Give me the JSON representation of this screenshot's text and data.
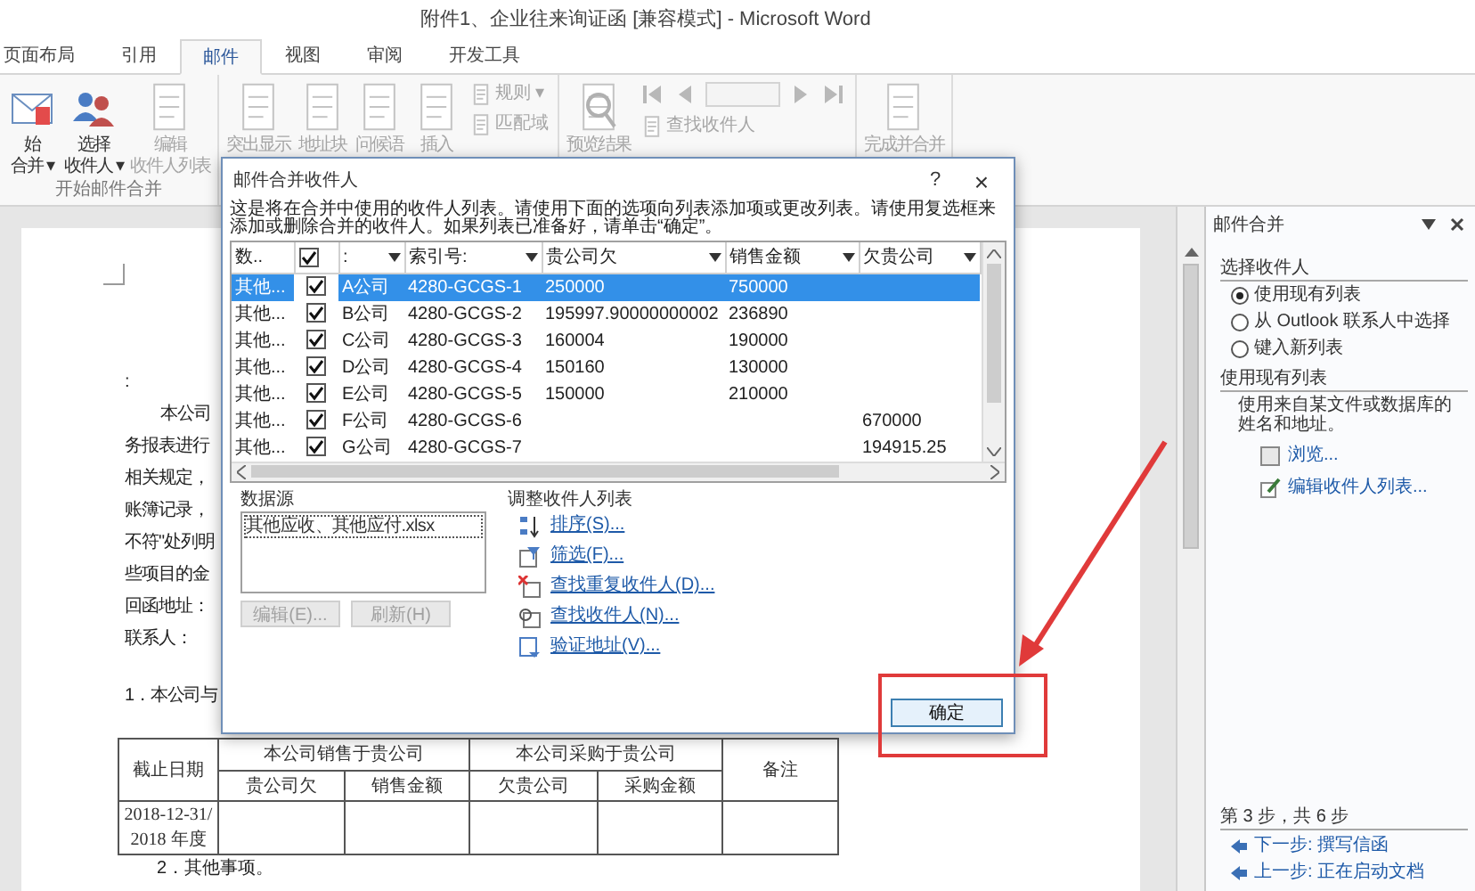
{
  "window": {
    "title": "附件1、企业往来询证函 [兼容模式] - Microsoft Word"
  },
  "tabs": [
    {
      "label": "页面布局",
      "selected": false
    },
    {
      "label": "引用",
      "selected": false
    },
    {
      "label": "邮件",
      "selected": true
    },
    {
      "label": "视图",
      "selected": false
    },
    {
      "label": "审阅",
      "selected": false
    },
    {
      "label": "开发工具",
      "selected": false
    }
  ],
  "ribbon_groups": [
    {
      "label": "开始邮件合并",
      "items": [
        {
          "kind": "large",
          "lines": [
            "始",
            "合并 ▾"
          ],
          "disabled": false
        },
        {
          "kind": "large",
          "lines": [
            "选择",
            "收件人 ▾"
          ],
          "disabled": false
        },
        {
          "kind": "large",
          "lines": [
            "编辑",
            "收件人列表"
          ],
          "disabled": true
        }
      ]
    },
    {
      "items": [
        {
          "kind": "large",
          "lines": [
            "突出显示"
          ],
          "disabled": true
        },
        {
          "kind": "large",
          "lines": [
            "地址块"
          ],
          "disabled": true
        },
        {
          "kind": "large",
          "lines": [
            "问候语"
          ],
          "disabled": true
        },
        {
          "kind": "large",
          "lines": [
            "插入"
          ],
          "disabled": true
        },
        {
          "kind": "small_stack",
          "entries": [
            "规则 ▾",
            "匹配域"
          ],
          "disabled": true
        }
      ]
    },
    {
      "items": [
        {
          "kind": "large",
          "lines": [
            "预览结果"
          ],
          "disabled": true
        },
        {
          "kind": "nav",
          "entries": [
            "查找收件人"
          ],
          "disabled": true
        }
      ]
    },
    {
      "items": [
        {
          "kind": "large",
          "lines": [
            "完成并合并"
          ],
          "disabled": true
        }
      ]
    }
  ],
  "document": {
    "lines": [
      {
        "kind": "plain",
        "text": ":"
      },
      {
        "kind": "first_line",
        "text": "本公司"
      },
      {
        "kind": "plain",
        "text": "务报表进行"
      },
      {
        "kind": "plain",
        "text": "相关规定，"
      },
      {
        "kind": "plain",
        "text": "账簿记录，"
      },
      {
        "kind": "plain",
        "text": "不符\"处列明"
      },
      {
        "kind": "plain",
        "text": "些项目的金"
      },
      {
        "kind": "plain",
        "text": "回函地址："
      },
      {
        "kind": "plain",
        "text": "联系人："
      }
    ],
    "item_1": "1．本公司与",
    "table": {
      "date_header": "截止日期",
      "group_headers": [
        "本公司销售于贵公司",
        "本公司采购于贵公司"
      ],
      "note_header": "备注",
      "sub_headers": [
        "贵公司欠",
        "销售金额",
        "欠贵公司",
        "采购金额"
      ],
      "rows": [
        {
          "date_lines": [
            "2018-12-31/",
            "2018 年度"
          ]
        }
      ]
    },
    "item_2": "2．其他事项。"
  },
  "task_pane": {
    "title": "邮件合并",
    "section_1": "选择收件人",
    "options": [
      {
        "label": "使用现有列表",
        "selected": true
      },
      {
        "label": "从 Outlook 联系人中选择",
        "selected": false
      },
      {
        "label": "键入新列表",
        "selected": false
      }
    ],
    "section_2": "使用现有列表",
    "description": "使用来自某文件或数据库的姓名和地址。",
    "links": [
      "浏览...",
      "编辑收件人列表..."
    ],
    "step": "第 3 步，共 6 步",
    "next": "下一步: 撰写信函",
    "previous": "上一步: 正在启动文档"
  },
  "dialog": {
    "title": "邮件合并收件人",
    "help": "?",
    "close": "×",
    "description": "这是将在合并中使用的收件人列表。请使用下面的选项向列表添加项或更改列表。请使用复选框来添加或删除合并的收件人。如果列表已准备好，请单击“确定”。",
    "columns": [
      "数..",
      ":",
      "索引号:",
      "贵公司欠",
      "销售金额",
      "欠贵公司"
    ],
    "header_checked": true,
    "rows": [
      {
        "selected": true,
        "checked": true,
        "source": "其他...",
        "name": "A公司",
        "index": "4280-GCGS-1",
        "owed": "250000",
        "sales": "750000"
      },
      {
        "selected": false,
        "checked": true,
        "source": "其他...",
        "name": "B公司",
        "index": "4280-GCGS-2",
        "owed": "195997.90000000002",
        "sales": "236890"
      },
      {
        "selected": false,
        "checked": true,
        "source": "其他...",
        "name": "C公司",
        "index": "4280-GCGS-3",
        "owed": "160004",
        "sales": "190000"
      },
      {
        "selected": false,
        "checked": true,
        "source": "其他...",
        "name": "D公司",
        "index": "4280-GCGS-4",
        "owed": "150160",
        "sales": "130000"
      },
      {
        "selected": false,
        "checked": true,
        "source": "其他...",
        "name": "E公司",
        "index": "4280-GCGS-5",
        "owed": "150000",
        "sales": "210000"
      },
      {
        "selected": false,
        "checked": true,
        "source": "其他...",
        "name": "F公司",
        "index": "4280-GCGS-6",
        "owed_to_us": "670000"
      },
      {
        "selected": false,
        "checked": true,
        "source": "其他...",
        "name": "G公司",
        "index": "4280-GCGS-7",
        "owed_to_us": "194915.25"
      }
    ],
    "data_source": {
      "label": "数据源",
      "files": [
        "其他应收、其他应付.xlsx"
      ],
      "buttons": [
        {
          "label": "编辑(E)...",
          "disabled": true
        },
        {
          "label": "刷新(H)",
          "disabled": true
        }
      ]
    },
    "adjust": {
      "label": "调整收件人列表",
      "links": [
        "排序(S)...",
        "筛选(F)...",
        "查找重复收件人(D)...",
        "查找收件人(N)...",
        "验证地址(V)..."
      ]
    },
    "ok": "确定"
  },
  "annotations": [
    {
      "kind": "box"
    },
    {
      "kind": "arrow"
    }
  ]
}
